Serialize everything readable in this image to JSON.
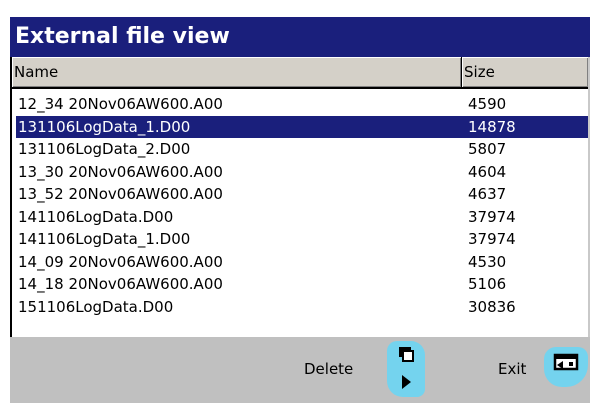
{
  "window": {
    "title": "External file view"
  },
  "list": {
    "columns": {
      "name": "Name",
      "size": "Size"
    },
    "rows": [
      {
        "name": "12_34 20Nov06AW600.A00",
        "size": "4590",
        "selected": false
      },
      {
        "name": "131106LogData_1.D00",
        "size": "14878",
        "selected": true
      },
      {
        "name": "131106LogData_2.D00",
        "size": "5807",
        "selected": false
      },
      {
        "name": "13_30 20Nov06AW600.A00",
        "size": "4604",
        "selected": false
      },
      {
        "name": "13_52 20Nov06AW600.A00",
        "size": "4637",
        "selected": false
      },
      {
        "name": "141106LogData.D00",
        "size": "37974",
        "selected": false
      },
      {
        "name": "141106LogData_1.D00",
        "size": "37974",
        "selected": false
      },
      {
        "name": "14_09 20Nov06AW600.A00",
        "size": "4530",
        "selected": false
      },
      {
        "name": "14_18 20Nov06AW600.A00",
        "size": "5106",
        "selected": false
      },
      {
        "name": "151106LogData.D00",
        "size": "30836",
        "selected": false
      }
    ]
  },
  "toolbar": {
    "delete_label": "Delete",
    "exit_label": "Exit",
    "delete_icon": "delete-key-icon",
    "exit_icon": "exit-key-icon"
  },
  "colors": {
    "title_bar": "#1a1f7c",
    "selection": "#1a1f7c",
    "toolbar": "#c0c0c0",
    "key_icon": "#74d3ee"
  }
}
